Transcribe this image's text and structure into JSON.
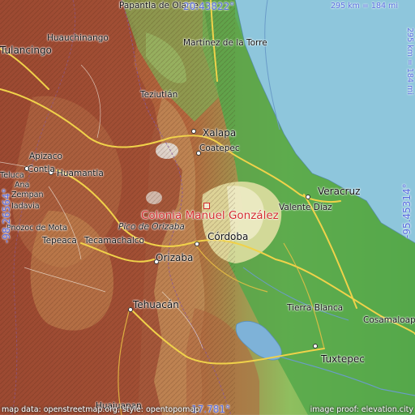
{
  "map": {
    "title": "Colonia Manuel González",
    "coords": {
      "top": "20.43822°",
      "bottom": "17.781°",
      "left": "-98.26564°",
      "right": "-95.45314°"
    },
    "scale": {
      "top": "295 km = 184 mi",
      "right": "295 km = 184 mi"
    },
    "attribution": {
      "left": "map data: openstreetmap.org, style: opentopomap",
      "right": "image proof: elevation.city"
    },
    "colors": {
      "sea": "#8ec6dc",
      "lowland": "#4fa84a",
      "plain": "#b8d79a",
      "upland": "#c2a16a",
      "mountain": "#a64b33",
      "label": "#d42d2d",
      "coord": "#5a6ee0"
    },
    "places": [
      {
        "name": "Papantla de Olarte",
        "id": "papantla"
      },
      {
        "name": "Huauchinango",
        "id": "huauchinango"
      },
      {
        "name": "Tulancingo",
        "id": "tulancingo"
      },
      {
        "name": "Martínez de la Torre",
        "id": "martinez"
      },
      {
        "name": "Teziutlán",
        "id": "teziutlan"
      },
      {
        "name": "Xalapa",
        "id": "xalapa"
      },
      {
        "name": "Coatepec",
        "id": "coatepec"
      },
      {
        "name": "Apizaco",
        "id": "apizaco"
      },
      {
        "name": "Huamantla",
        "id": "huamantla"
      },
      {
        "name": "Contla",
        "id": "contla"
      },
      {
        "name": "Veracruz",
        "id": "veracruz"
      },
      {
        "name": "Valente Díaz",
        "id": "valente"
      },
      {
        "name": "Pico de Orizaba",
        "id": "pico"
      },
      {
        "name": "Córdoba",
        "id": "cordoba"
      },
      {
        "name": "Orizaba",
        "id": "orizaba"
      },
      {
        "name": "Tepeaca",
        "id": "tepeaca"
      },
      {
        "name": "Tecamachalco",
        "id": "tecamachalco"
      },
      {
        "name": "Tehuacán",
        "id": "tehuacan"
      },
      {
        "name": "Tierra Blanca",
        "id": "tierra_blanca"
      },
      {
        "name": "Cosamaloapan",
        "id": "cosamaloapan"
      },
      {
        "name": "Tuxtepec",
        "id": "tuxtepec"
      },
      {
        "name": "Huajuapan",
        "id": "huajuapan"
      },
      {
        "name": "Teluca",
        "id": "teluca"
      },
      {
        "name": "Ana",
        "id": "ana"
      },
      {
        "name": "Zempan",
        "id": "zempan"
      },
      {
        "name": "Iadavia",
        "id": "iadavia"
      },
      {
        "name": "Pnozoc de Mota",
        "id": "mota"
      }
    ]
  }
}
